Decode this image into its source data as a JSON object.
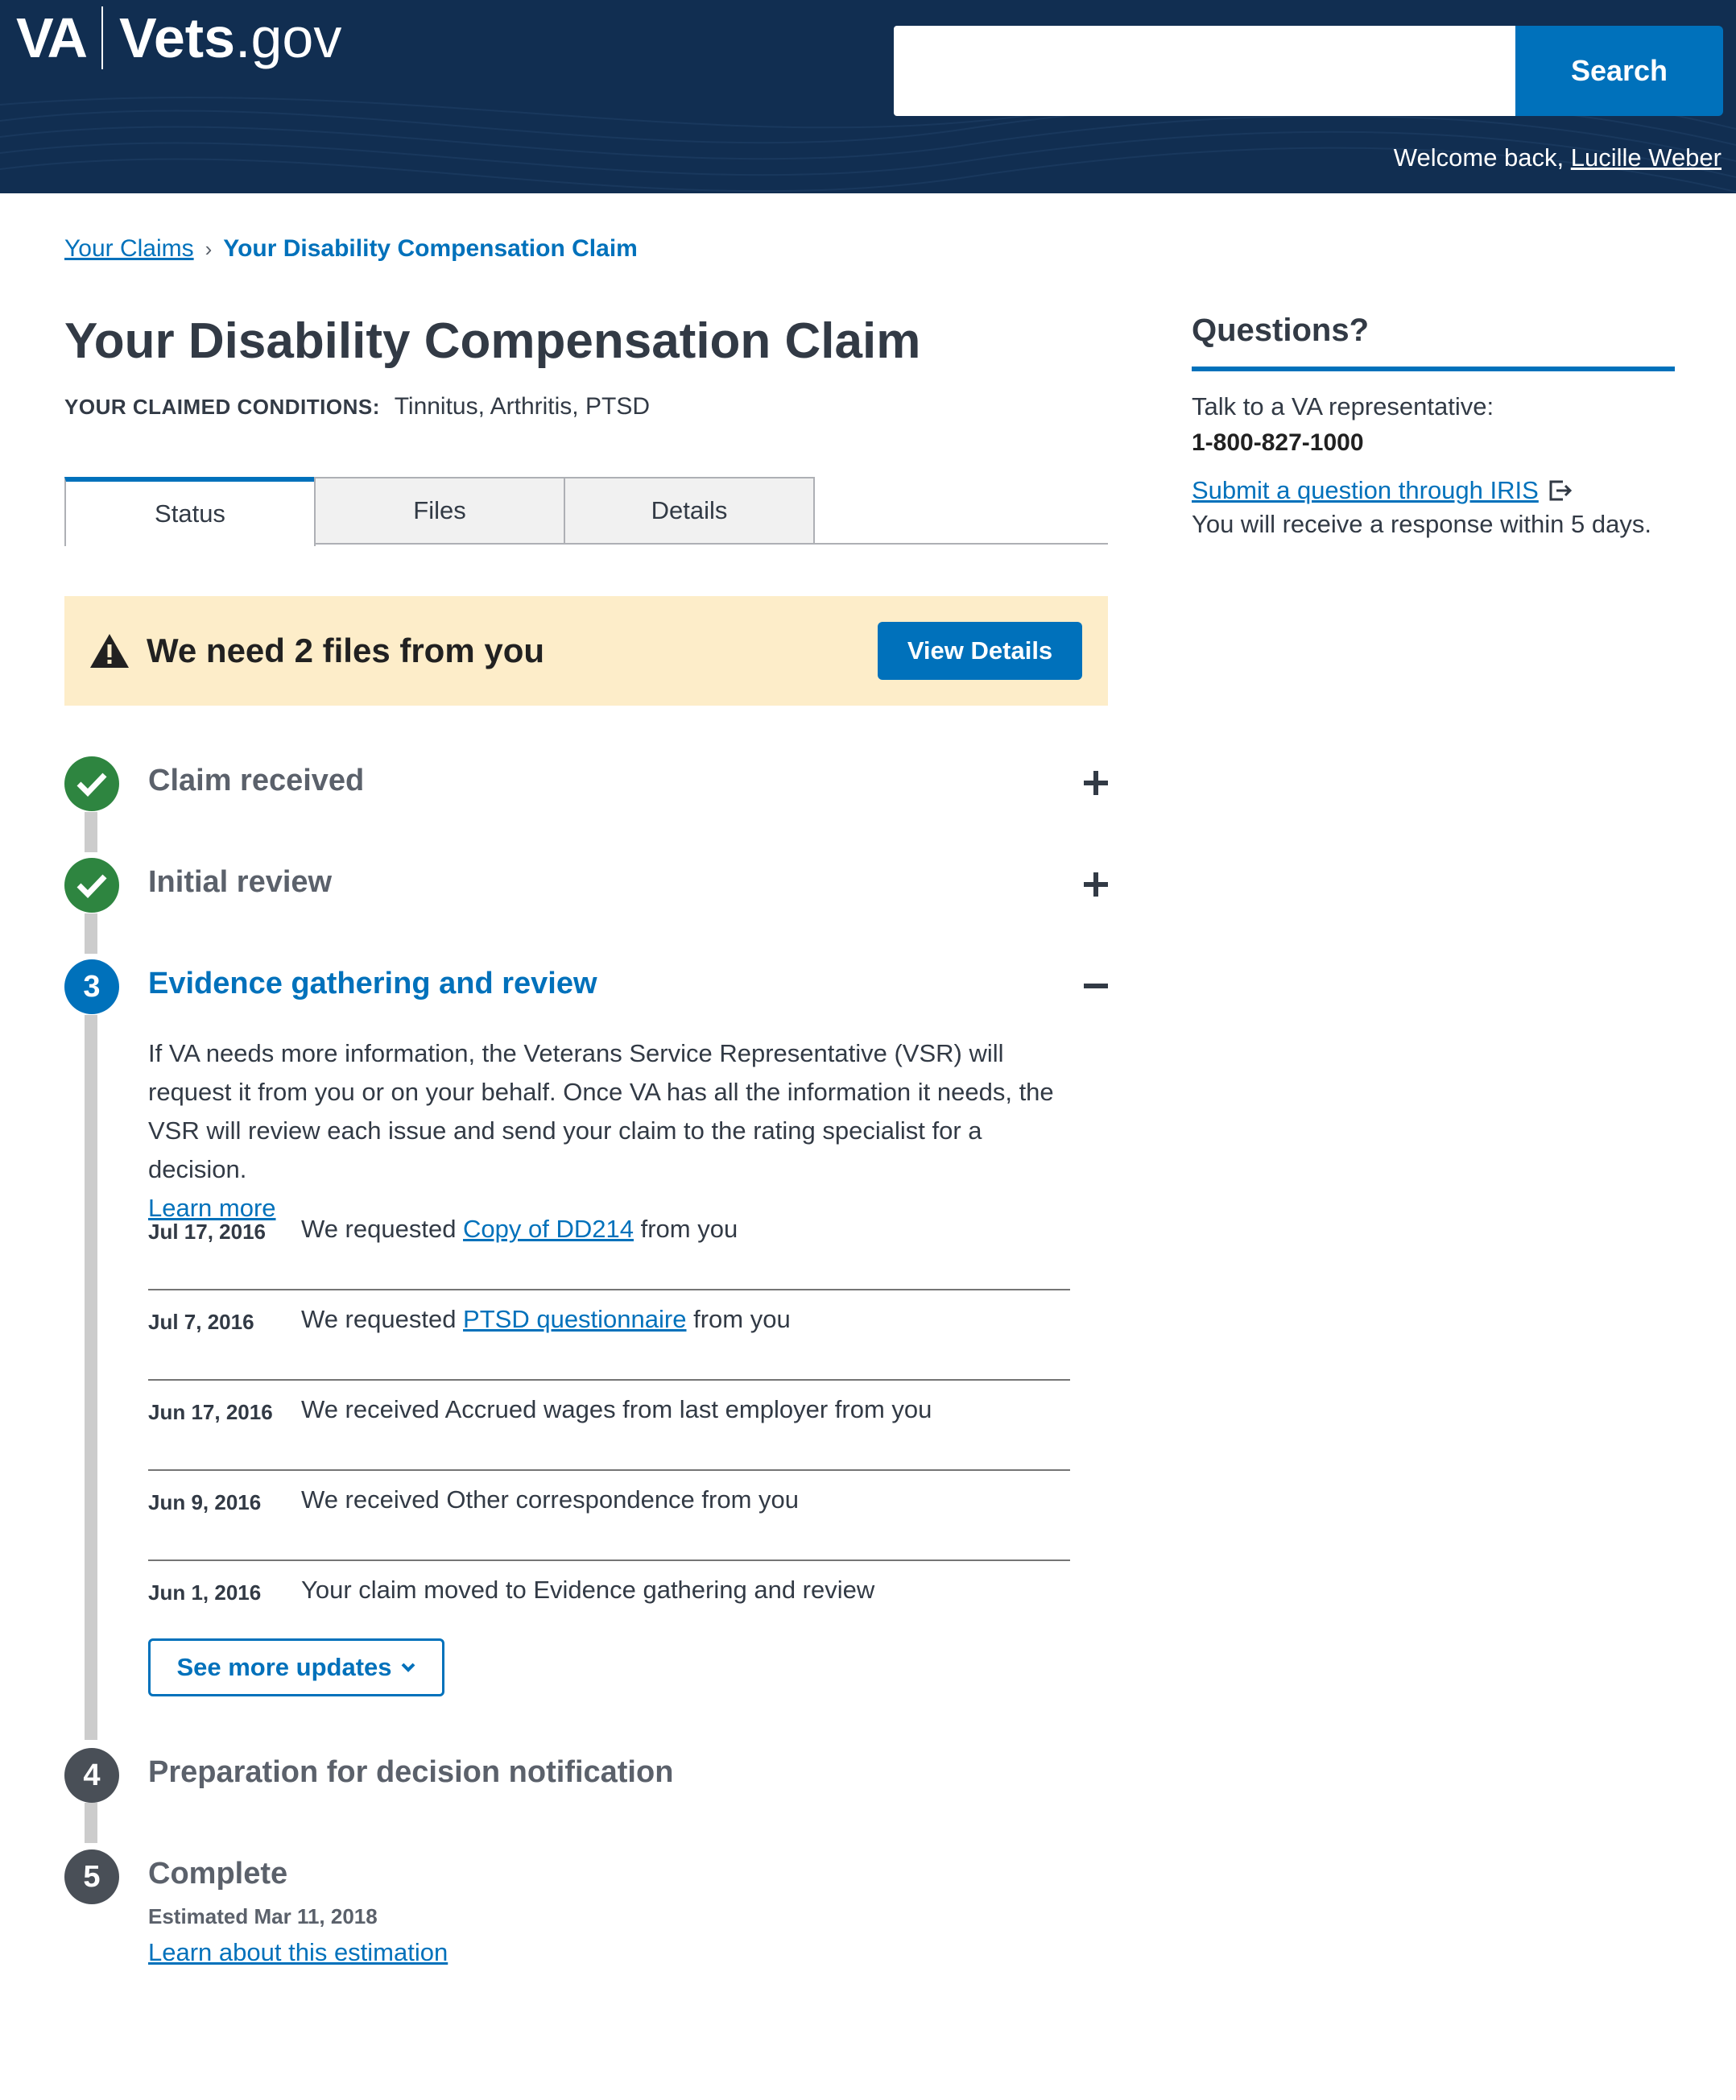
{
  "header": {
    "logo_va": "VA",
    "logo_vets": "Vets",
    "logo_gov": ".gov",
    "search_value": "",
    "search_button": "Search",
    "welcome_text": "Welcome back, ",
    "user_name": "Lucille Weber"
  },
  "breadcrumb": {
    "parent": "Your Claims",
    "separator": "›",
    "current": "Your Disability Compensation Claim"
  },
  "page": {
    "title": "Your Disability Compensation Claim",
    "conditions_label": "YOUR CLAIMED CONDITIONS:",
    "conditions_value": "Tinnitus, Arthritis, PTSD"
  },
  "tabs": [
    {
      "label": "Status",
      "active": true
    },
    {
      "label": "Files",
      "active": false
    },
    {
      "label": "Details",
      "active": false
    }
  ],
  "alert": {
    "icon": "warning-icon",
    "text": "We need 2 files from you",
    "button": "View Details"
  },
  "steps": [
    {
      "number": "1",
      "title": "Claim received",
      "state": "done",
      "toggle": "expand"
    },
    {
      "number": "2",
      "title": "Initial review",
      "state": "done",
      "toggle": "expand"
    },
    {
      "number": "3",
      "title": "Evidence gathering and review",
      "state": "current",
      "toggle": "collapse"
    },
    {
      "number": "4",
      "title": "Preparation for decision notification",
      "state": "future"
    },
    {
      "number": "5",
      "title": "Complete",
      "state": "future"
    }
  ],
  "current_step": {
    "description": "If VA needs more information, the Veterans Service Representative (VSR) will request it from you or on your behalf. Once VA has all the information it needs, the VSR will review each issue and send your claim to the rating specialist for a decision.",
    "learn_more": "Learn more",
    "updates": [
      {
        "date": "Jul 17, 2016",
        "pre": "We requested ",
        "link": "Copy of DD214",
        "post": " from you"
      },
      {
        "date": "Jul 7, 2016",
        "pre": "We requested ",
        "link": "PTSD questionnaire",
        "post": " from you"
      },
      {
        "date": "Jun 17, 2016",
        "pre": "We received Accrued wages from last employer from you",
        "link": "",
        "post": ""
      },
      {
        "date": "Jun 9, 2016",
        "pre": "We received Other correspondence from you",
        "link": "",
        "post": ""
      },
      {
        "date": "Jun 1, 2016",
        "pre": "Your claim moved to Evidence gathering and review",
        "link": "",
        "post": ""
      }
    ],
    "see_more": "See more updates"
  },
  "complete": {
    "estimate": "Estimated Mar 11, 2018",
    "estimate_link": "Learn about this estimation"
  },
  "sidebar": {
    "title": "Questions?",
    "talk": "Talk to a VA representative:",
    "phone": "1-800-827-1000",
    "iris_link": "Submit a question through IRIS",
    "response": "You will receive a response within 5 days."
  },
  "colors": {
    "header_bg": "#112e51",
    "primary": "#0071bb",
    "success": "#2e8540",
    "alert_bg": "#fdedc9",
    "future_step": "#494f57"
  }
}
